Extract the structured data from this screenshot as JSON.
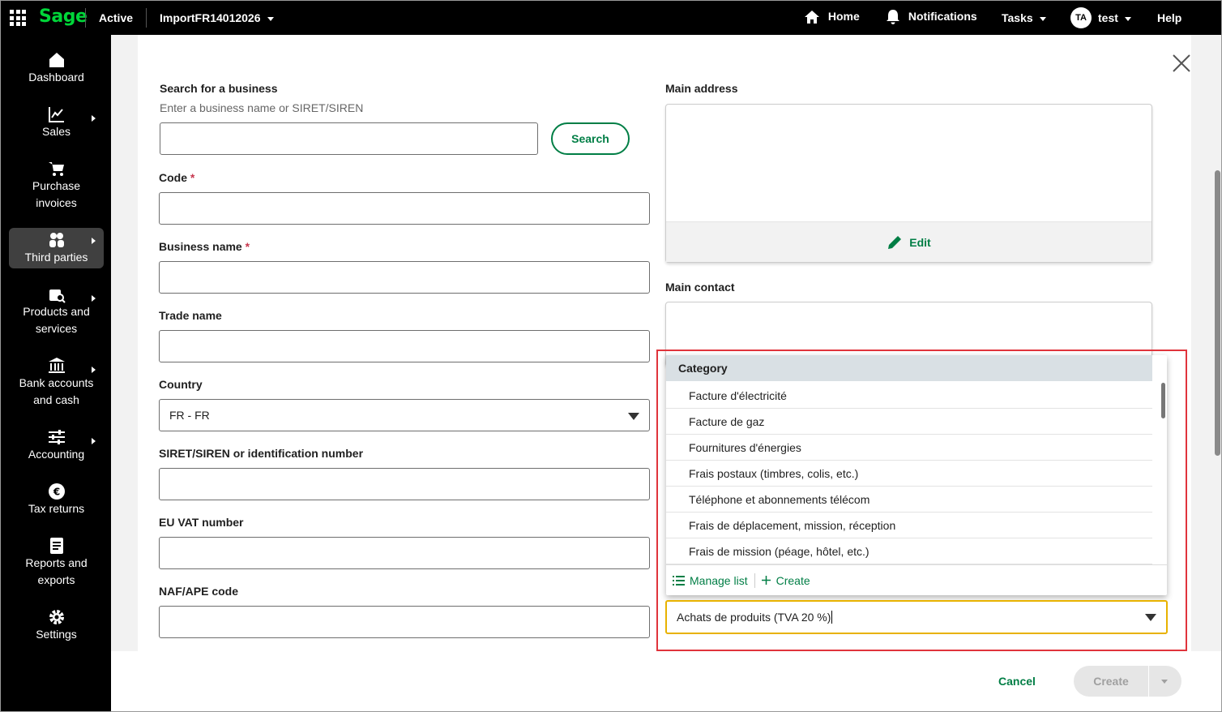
{
  "topbar": {
    "logo": "Sage",
    "status": "Active",
    "company": "ImportFR14012026",
    "home": "Home",
    "notifications": "Notifications",
    "tasks": "Tasks",
    "avatar": "TA",
    "user": "test",
    "help": "Help"
  },
  "sidebar": {
    "items": [
      {
        "line1": "Dashboard",
        "line2": ""
      },
      {
        "line1": "Sales",
        "line2": ""
      },
      {
        "line1": "Purchase",
        "line2": "invoices"
      },
      {
        "line1": "Third parties",
        "line2": ""
      },
      {
        "line1": "Products and",
        "line2": "services"
      },
      {
        "line1": "Bank accounts",
        "line2": "and cash"
      },
      {
        "line1": "Accounting",
        "line2": ""
      },
      {
        "line1": "Tax returns",
        "line2": ""
      },
      {
        "line1": "Reports and",
        "line2": "exports"
      },
      {
        "line1": "Settings",
        "line2": ""
      }
    ]
  },
  "form": {
    "search_label": "Search for a business",
    "search_hint": "Enter a business name or SIRET/SIREN",
    "search_value": "",
    "search_button": "Search",
    "code_label": "Code",
    "required_mark": "*",
    "code_value": "",
    "business_name_label": "Business name",
    "business_name_value": "",
    "trade_name_label": "Trade name",
    "trade_name_value": "",
    "country_label": "Country",
    "country_value": "FR - FR",
    "siret_label": "SIRET/SIREN or identification number",
    "siret_value": "",
    "vat_label": "EU VAT number",
    "vat_value": "",
    "naf_label": "NAF/APE code",
    "naf_value": "",
    "main_address_label": "Main address",
    "edit_label": "Edit",
    "main_contact_label": "Main contact"
  },
  "category_dropdown": {
    "header": "Category",
    "options": [
      "Facture d'électricité",
      "Facture de gaz",
      "Fournitures d'énergies",
      "Frais postaux (timbres, colis, etc.)",
      "Téléphone et abonnements télécom",
      "Frais de déplacement, mission, réception",
      "Frais de mission (péage, hôtel, etc.)"
    ],
    "manage_list": "Manage list",
    "create": "Create",
    "input_value": "Achats de produits (TVA 20 %)"
  },
  "footer": {
    "cancel": "Cancel",
    "create": "Create"
  },
  "colors": {
    "brand_green": "#007e45",
    "logo_green": "#00d639",
    "highlight_red": "#e0343c",
    "focus_yellow": "#e8b200"
  }
}
